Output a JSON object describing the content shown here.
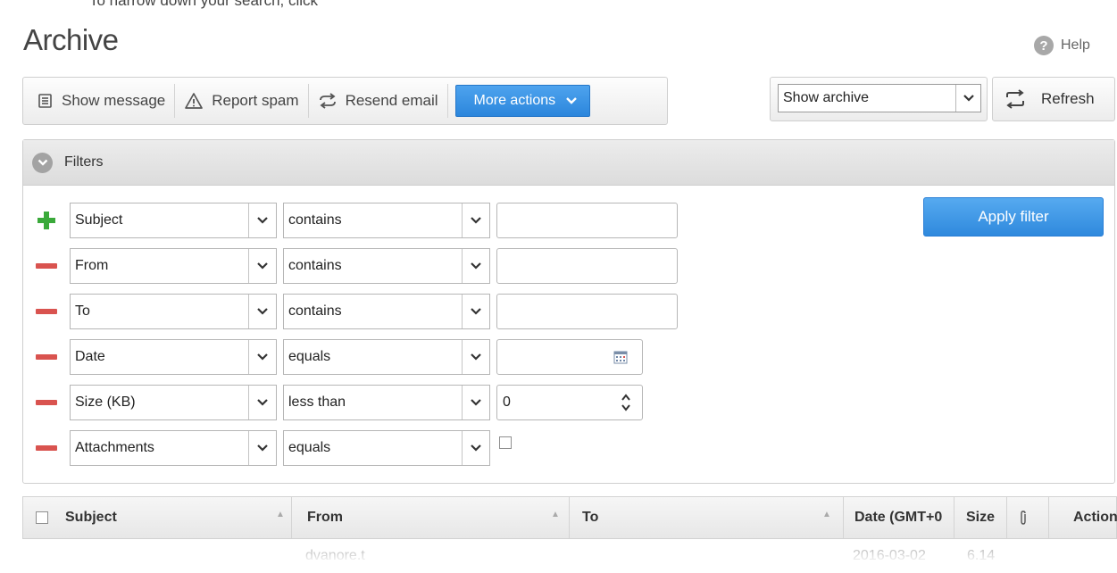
{
  "top_text": "To narrow down your search, click",
  "page": {
    "title": "Archive",
    "help_label": "Help"
  },
  "toolbar": {
    "show_message": "Show message",
    "report_spam": "Report spam",
    "resend_email": "Resend email",
    "more_actions": "More actions"
  },
  "archive_select": {
    "value": "Show archive"
  },
  "refresh_label": "Refresh",
  "filters": {
    "header": "Filters",
    "apply_label": "Apply filter",
    "rows": [
      {
        "field": "Subject",
        "operator": "contains",
        "value": ""
      },
      {
        "field": "From",
        "operator": "contains",
        "value": ""
      },
      {
        "field": "To",
        "operator": "contains",
        "value": ""
      },
      {
        "field": "Date",
        "operator": "equals",
        "value": ""
      },
      {
        "field": "Size (KB)",
        "operator": "less than",
        "value": "0"
      },
      {
        "field": "Attachments",
        "operator": "equals",
        "value": ""
      }
    ]
  },
  "table": {
    "columns": [
      "Subject",
      "From",
      "To",
      "Date (GMT+0",
      "Size",
      "Action"
    ],
    "first_row": {
      "from": "dvanore.t",
      "date": "2016-03-02",
      "size": "6.14"
    }
  },
  "colors": {
    "accent": "#2f89dd",
    "add": "#3aa93a",
    "remove": "#d9534f"
  }
}
